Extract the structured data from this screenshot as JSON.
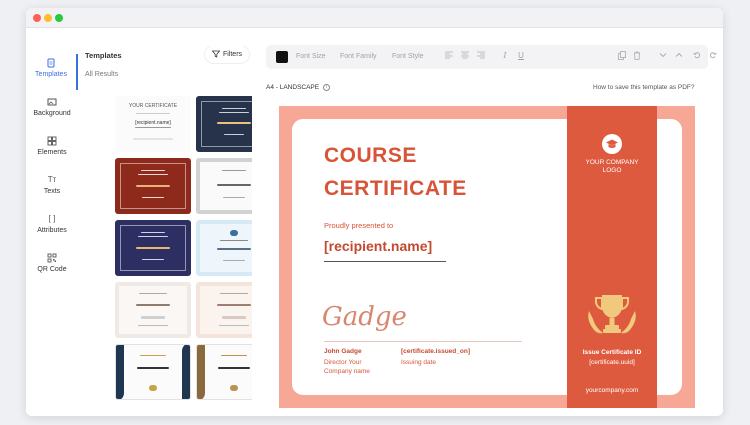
{
  "rail": {
    "items": [
      {
        "label": "Templates",
        "icon": "template-icon",
        "active": true
      },
      {
        "label": "Background",
        "icon": "background-icon",
        "active": false
      },
      {
        "label": "Elements",
        "icon": "elements-icon",
        "active": false
      },
      {
        "label": "Texts",
        "icon": "text-icon",
        "active": false
      },
      {
        "label": "Attributes",
        "icon": "brackets-icon",
        "active": false
      },
      {
        "label": "QR Code",
        "icon": "qr-code-icon",
        "active": false
      }
    ]
  },
  "templates_panel": {
    "title": "Templates",
    "subtitle": "All Results",
    "filters_label": "Filters",
    "thumb_first_title": "YOUR CERTIFICATE",
    "thumb_placeholder": "[recipient.name]"
  },
  "toolbar": {
    "font_size_placeholder": "Font Size",
    "font_family_placeholder": "Font Family",
    "font_style_placeholder": "Font Style",
    "swatch_color": "#111111"
  },
  "canvas": {
    "page_size": "A4 - LANDSCAPE",
    "help_link": "How to save this template as PDF?"
  },
  "certificate": {
    "title_line1": "COURSE",
    "title_line2": "CERTIFICATE",
    "presented_to": "Proudly presented to",
    "recipient": "[recipient.name]",
    "signature": "Gadge",
    "signer_name": "John Gadge",
    "signer_role": "Director Your",
    "signer_company": "Company name",
    "issued_on": "[certificate.issued_on]",
    "issued_label": "Issuing date",
    "logo_line1": "YOUR COMPANY",
    "logo_line2": "LOGO",
    "issue_id_label": "Issue Certificate ID",
    "issue_id_value": "[certificate.uuid]",
    "website": "yourcompany.com",
    "colors": {
      "accent": "#de5a3e",
      "border": "#f6a795",
      "title": "#d85438"
    }
  }
}
